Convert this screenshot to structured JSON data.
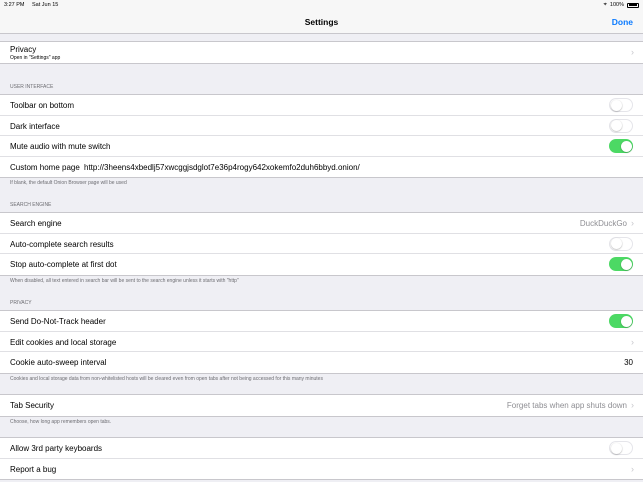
{
  "status_bar": {
    "time": "3:27 PM",
    "date": "Sat Jun 15",
    "battery": "100%"
  },
  "nav": {
    "title": "Settings",
    "done": "Done"
  },
  "privacy_link": {
    "label": "Privacy",
    "sub": "Open in \"Settings\" app"
  },
  "ui_section": {
    "header": "USER INTERFACE",
    "toolbar_bottom": {
      "label": "Toolbar on bottom",
      "on": false
    },
    "dark_interface": {
      "label": "Dark interface",
      "on": false
    },
    "mute_audio": {
      "label": "Mute audio with mute switch",
      "on": true
    },
    "home_page": {
      "label": "Custom home page",
      "value": "http://3heens4xbedlj57xwcggjsdglot7e36p4rogy642xokemfo2duh6bbyd.onion/"
    },
    "footer": "If blank, the default Onion Browser page will be used"
  },
  "search_section": {
    "header": "SEARCH ENGINE",
    "engine": {
      "label": "Search engine",
      "value": "DuckDuckGo"
    },
    "autocomplete": {
      "label": "Auto-complete search results",
      "on": false
    },
    "stop_dot": {
      "label": "Stop auto-complete at first dot",
      "on": true
    },
    "footer": "When disabled, all text entered in search bar will be sent to the search engine unless it starts with \"http\""
  },
  "privacy_section": {
    "header": "PRIVACY",
    "dnt": {
      "label": "Send Do-Not-Track header",
      "on": true
    },
    "cookies": {
      "label": "Edit cookies and local storage"
    },
    "sweep": {
      "label": "Cookie auto-sweep interval",
      "value": "30"
    },
    "footer": "Cookies and local storage data from non-whitelisted hosts will be cleared even from open tabs after not being accessed for this many minutes"
  },
  "tab_section": {
    "tab_security": {
      "label": "Tab Security",
      "value": "Forget tabs when app shuts down"
    },
    "footer": "Choose, how long app remembers open tabs."
  },
  "misc_section": {
    "keyboards": {
      "label": "Allow 3rd party keyboards",
      "on": false
    },
    "bug": {
      "label": "Report a bug"
    }
  }
}
